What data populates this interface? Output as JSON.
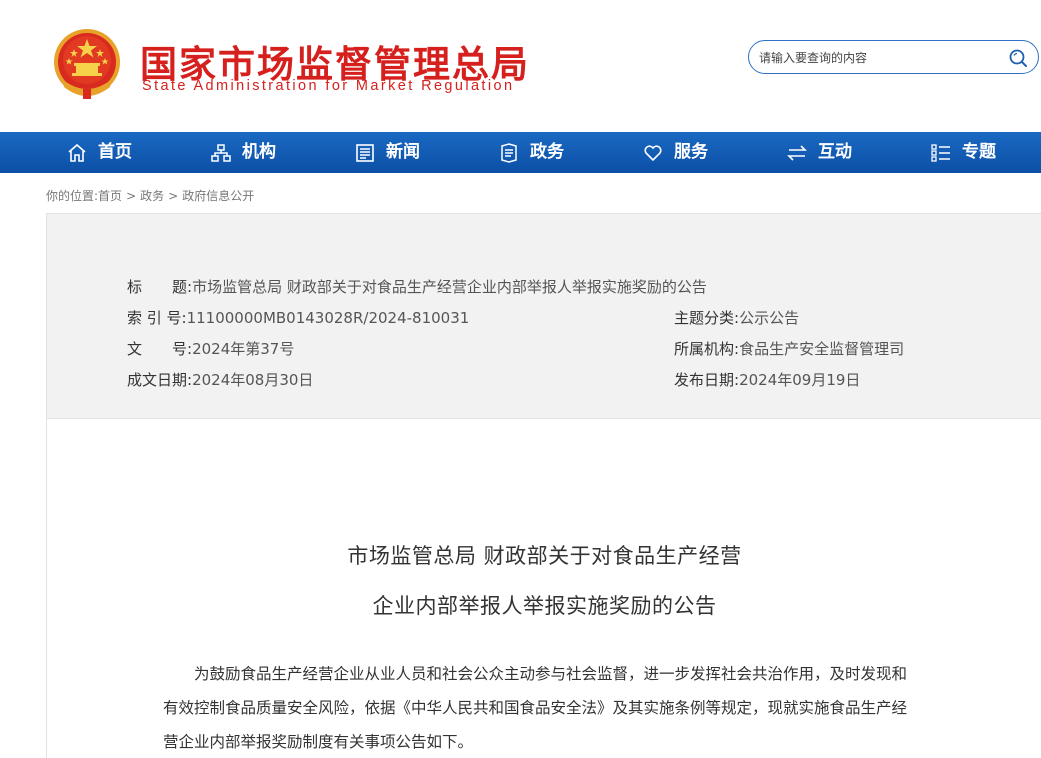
{
  "header": {
    "title_cn": "国家市场监督管理总局",
    "title_en": "State Administration for Market Regulation",
    "search_placeholder": "请输入要查询的内容",
    "brand_color": "#d6201d"
  },
  "nav": {
    "items": [
      {
        "label": "首页",
        "icon": "home-icon"
      },
      {
        "label": "机构",
        "icon": "org-chart-icon"
      },
      {
        "label": "新闻",
        "icon": "news-icon"
      },
      {
        "label": "政务",
        "icon": "document-icon"
      },
      {
        "label": "服务",
        "icon": "heart-icon"
      },
      {
        "label": "互动",
        "icon": "exchange-icon"
      },
      {
        "label": "专题",
        "icon": "list-icon"
      }
    ],
    "color": "#0c4fa6"
  },
  "breadcrumb": {
    "prefix": "你的位置:",
    "items": [
      "首页",
      "政务",
      "政府信息公开"
    ]
  },
  "meta": {
    "title_label": "标　　题:",
    "title_value": "市场监管总局 财政部关于对食品生产经营企业内部举报人举报实施奖励的公告",
    "index_label": "索 引 号:",
    "index_value": "11100000MB0143028R/2024-810031",
    "docno_label": "文　　号:",
    "docno_value": "2024年第37号",
    "created_label": "成文日期:",
    "created_value": "2024年08月30日",
    "category_label": "主题分类:",
    "category_value": "公示公告",
    "org_label": "所属机构:",
    "org_value": "食品生产安全监督管理司",
    "published_label": "发布日期:",
    "published_value": "2024年09月19日"
  },
  "document": {
    "title_line1": "市场监管总局 财政部关于对食品生产经营",
    "title_line2": "企业内部举报人举报实施奖励的公告",
    "para1_line1": "　　为鼓励食品生产经营企业从业人员和社会公众主动参与社会监督，进一步发挥社会共治作用，及时发现和",
    "para1_line2": "有效控制食品质量安全风险，依据《中华人民共和国食品安全法》及其实施条例等规定，现就实施食品生产经",
    "para1_line3": "营企业内部举报奖励制度有关事项公告如下。"
  }
}
